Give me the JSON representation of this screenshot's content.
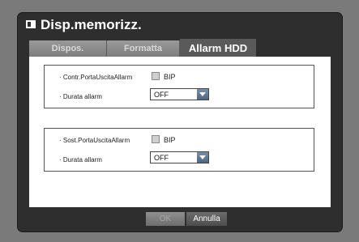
{
  "window": {
    "title": "Disp.memorizz."
  },
  "tabs": [
    {
      "label": "Dispos."
    },
    {
      "label": "Formatta"
    },
    {
      "label": "Allarm HDD"
    }
  ],
  "groups": [
    {
      "port_label": "· Contr.PortaUscitaAllarm",
      "checkbox_label": "BIP",
      "duration_label": "· Durata allarm",
      "duration_value": "OFF"
    },
    {
      "port_label": "· Sost.PortaUscitaAllarm",
      "checkbox_label": "BIP",
      "duration_label": "· Durata allarm",
      "duration_value": "OFF"
    }
  ],
  "footer": {
    "ok_label": "OK",
    "cancel_label": "Annulla"
  },
  "icons": {
    "title": "storage-icon",
    "dropdown": "chevron-down-icon"
  }
}
